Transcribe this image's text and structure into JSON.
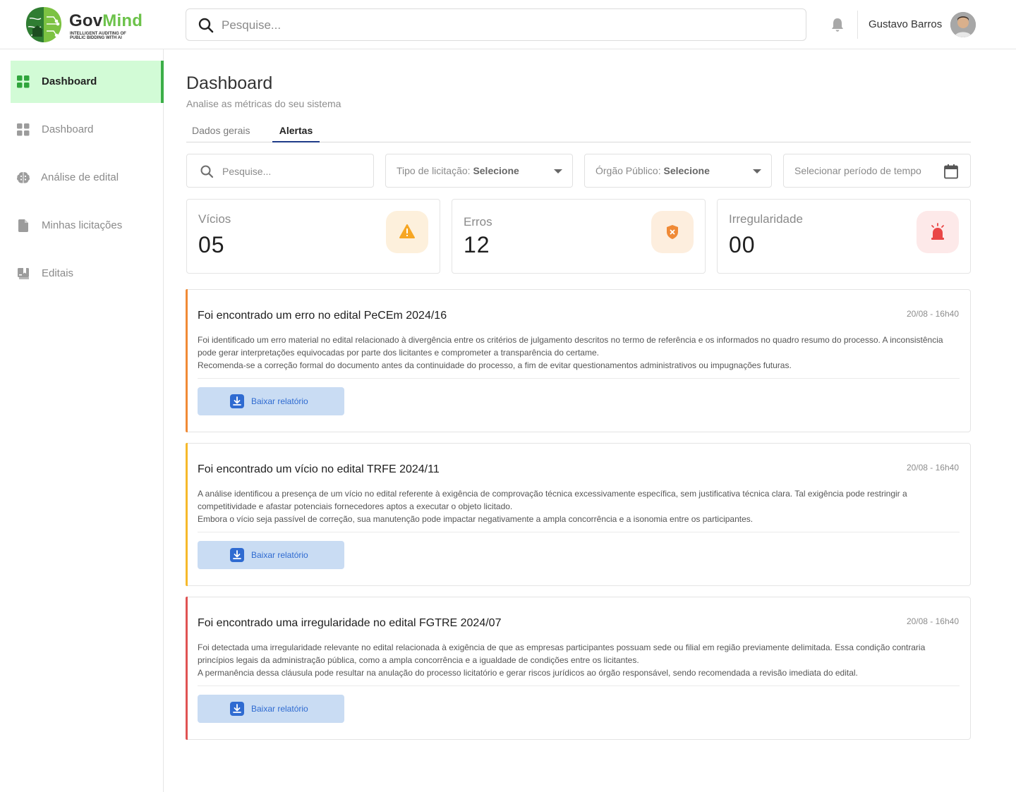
{
  "header": {
    "logo": {
      "name_part1": "Gov",
      "name_part2": "Mind",
      "tagline": "Intelligent auditing of public bidding with AI"
    },
    "search_placeholder": "Pesquise...",
    "user_name": "Gustavo Barros"
  },
  "sidebar": {
    "items": [
      {
        "label": "Dashboard",
        "icon": "grid-icon",
        "active": true
      },
      {
        "label": "Dashboard",
        "icon": "grid-icon",
        "active": false
      },
      {
        "label": "Análise de edital",
        "icon": "brain-icon",
        "active": false
      },
      {
        "label": "Minhas licitações",
        "icon": "document-icon",
        "active": false
      },
      {
        "label": "Editais",
        "icon": "bookmark-book-icon",
        "active": false
      }
    ]
  },
  "main": {
    "title": "Dashboard",
    "subtitle": "Analise as métricas do seu sistema",
    "tabs": [
      {
        "label": "Dados gerais",
        "active": false
      },
      {
        "label": "Alertas",
        "active": true
      }
    ],
    "filters": {
      "search_placeholder": "Pesquise...",
      "tipo_label": "Tipo de licitação:",
      "tipo_value": "Selecione",
      "orgao_label": "Órgão Público:",
      "orgao_value": "Selecione",
      "date_label": "Selecionar período de tempo"
    },
    "stats": [
      {
        "label": "Vícios",
        "value": "05",
        "icon": "warning-icon",
        "color": "#f6a623",
        "bg": "#fdf0dc"
      },
      {
        "label": "Erros",
        "value": "12",
        "icon": "shield-x-icon",
        "color": "#f08a36",
        "bg": "#fdeede"
      },
      {
        "label": "Irregularidade",
        "value": "00",
        "icon": "siren-icon",
        "color": "#e94646",
        "bg": "#fde9e9"
      }
    ],
    "alerts": [
      {
        "title": "Foi encontrado um erro no edital PeCEm 2024/16",
        "date": "20/08 - 16h40",
        "accent": "#f08a36",
        "line1": "Foi identificado um erro material no edital relacionado à divergência entre os critérios de julgamento descritos no termo de referência e os informados no quadro resumo do processo. A inconsistência pode gerar interpretações equivocadas por parte dos licitantes e comprometer a transparência do certame.",
        "line2": "Recomenda-se a correção formal do documento antes da continuidade do processo, a fim de evitar questionamentos administrativos ou impugnações futuras.",
        "button": "Baixar relatório"
      },
      {
        "title": "Foi encontrado um vício no edital TRFE 2024/11",
        "date": "20/08 - 16h40",
        "accent": "#f6b92b",
        "line1": "A análise identificou a presença de um vício no edital referente à exigência de comprovação técnica excessivamente específica, sem justificativa técnica clara. Tal exigência pode restringir a competitividade e afastar potenciais fornecedores aptos a executar o objeto licitado.",
        "line2": "Embora o vício seja passível de correção, sua manutenção pode impactar negativamente a ampla concorrência e a isonomia entre os participantes.",
        "button": "Baixar relatório"
      },
      {
        "title": "Foi encontrado uma irregularidade no edital FGTRE 2024/07",
        "date": "20/08 - 16h40",
        "accent": "#e05353",
        "line1": "Foi detectada uma irregularidade relevante no edital relacionada à exigência de que as empresas participantes possuam sede ou filial em região previamente delimitada. Essa condição contraria princípios legais da administração pública, como a ampla concorrência e a igualdade de condições entre os licitantes.",
        "line2": "A permanência dessa cláusula pode resultar na anulação do processo licitatório e gerar riscos jurídicos ao órgão responsável, sendo recomendada a revisão imediata do edital.",
        "button": "Baixar relatório"
      }
    ]
  }
}
